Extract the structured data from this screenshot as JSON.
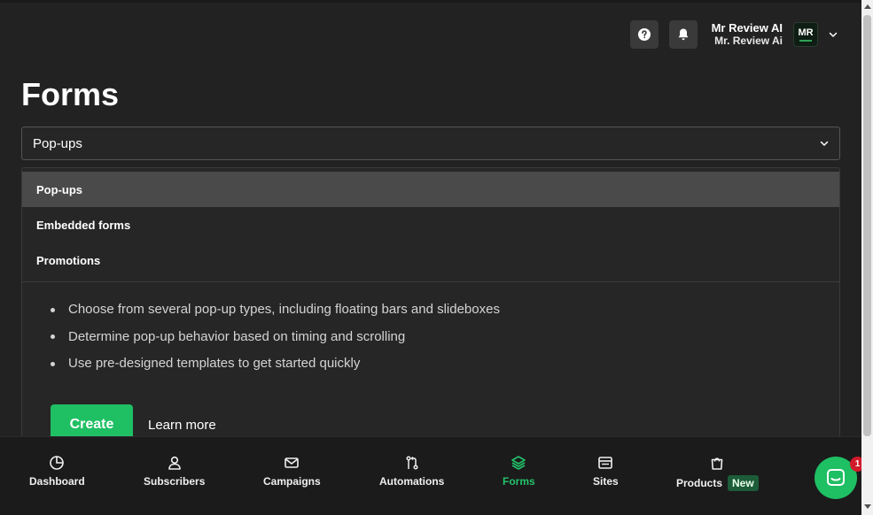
{
  "header": {
    "help_icon": "question-circle-icon",
    "notifications_icon": "bell-icon",
    "user_name": "Mr Review AI",
    "account_name": "Mr. Review Ai",
    "avatar_initials": "MR"
  },
  "page": {
    "title": "Forms"
  },
  "form_type_select": {
    "selected": "Pop-ups",
    "options": [
      "Pop-ups",
      "Embedded forms",
      "Promotions"
    ]
  },
  "description": {
    "bullets": [
      "Choose from several pop-up types, including floating bars and slideboxes",
      "Determine pop-up behavior based on timing and scrolling",
      "Use pre-designed templates to get started quickly"
    ],
    "create_label": "Create",
    "learn_more_label": "Learn more"
  },
  "bottom_nav": {
    "items": [
      {
        "label": "Dashboard",
        "icon": "pie-chart-icon"
      },
      {
        "label": "Subscribers",
        "icon": "user-icon"
      },
      {
        "label": "Campaigns",
        "icon": "mail-icon"
      },
      {
        "label": "Automations",
        "icon": "git-branch-icon"
      },
      {
        "label": "Forms",
        "icon": "layers-icon",
        "active": true
      },
      {
        "label": "Sites",
        "icon": "browser-window-icon"
      },
      {
        "label": "Products",
        "icon": "shopping-bag-icon",
        "badge": "New"
      }
    ]
  },
  "chat": {
    "unread_count": "1"
  },
  "colors": {
    "background": "#222222",
    "accent": "#1fbf64",
    "active_nav": "#22c36a",
    "badge_red": "#d11a2a"
  }
}
